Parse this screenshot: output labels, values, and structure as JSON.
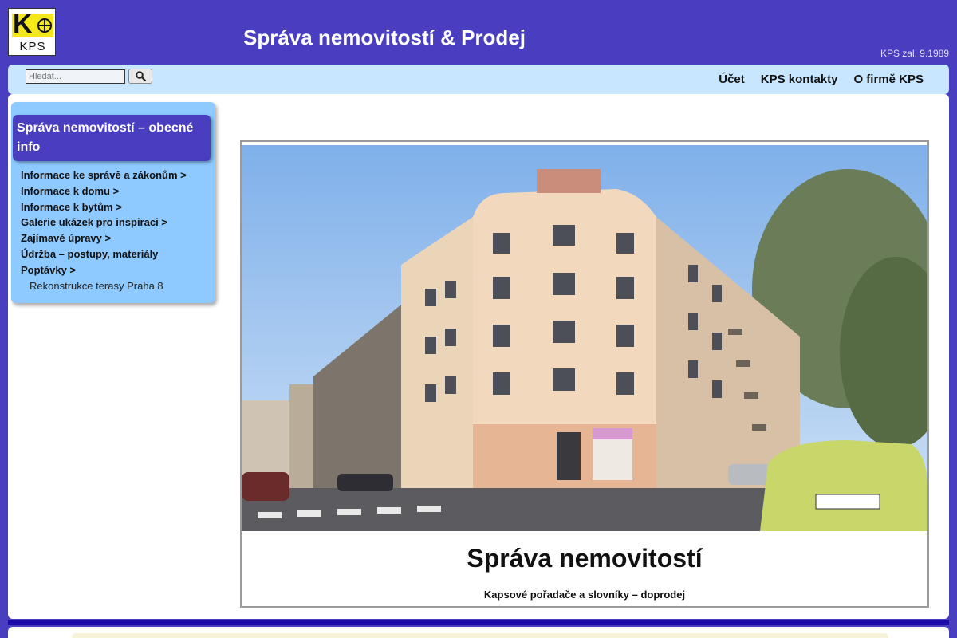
{
  "header": {
    "logo_text": "KPS",
    "logo_letter": "K",
    "title": "Správa nemovitostí & Prodej",
    "founded": "KPS zal. 9.1989"
  },
  "search": {
    "placeholder": "Hledat..."
  },
  "nav": {
    "links": [
      "Účet",
      "KPS kontakty",
      "O firmě KPS"
    ]
  },
  "sidebar": {
    "title": "Správa nemovitostí – obecné info",
    "items": [
      "Informace ke správě a zákonům >",
      "Informace k domu >",
      "Informace k bytům >",
      "Galerie ukázek pro inspiraci >",
      "Zajímavé úpravy >",
      "Údržba – postupy, materiály",
      "Poptávky >"
    ],
    "subitems": [
      "Rekonstrukce terasy Praha 8"
    ]
  },
  "feature": {
    "title": "Správa nemovitostí",
    "subtitle": "Kapsové pořadače a slovníky – doprodej"
  },
  "colors": {
    "brand": "#4a3ec0",
    "navbar": "#c8e6ff",
    "sidebar": "#8ecaff",
    "footer_bar": "#1a0aa8"
  }
}
